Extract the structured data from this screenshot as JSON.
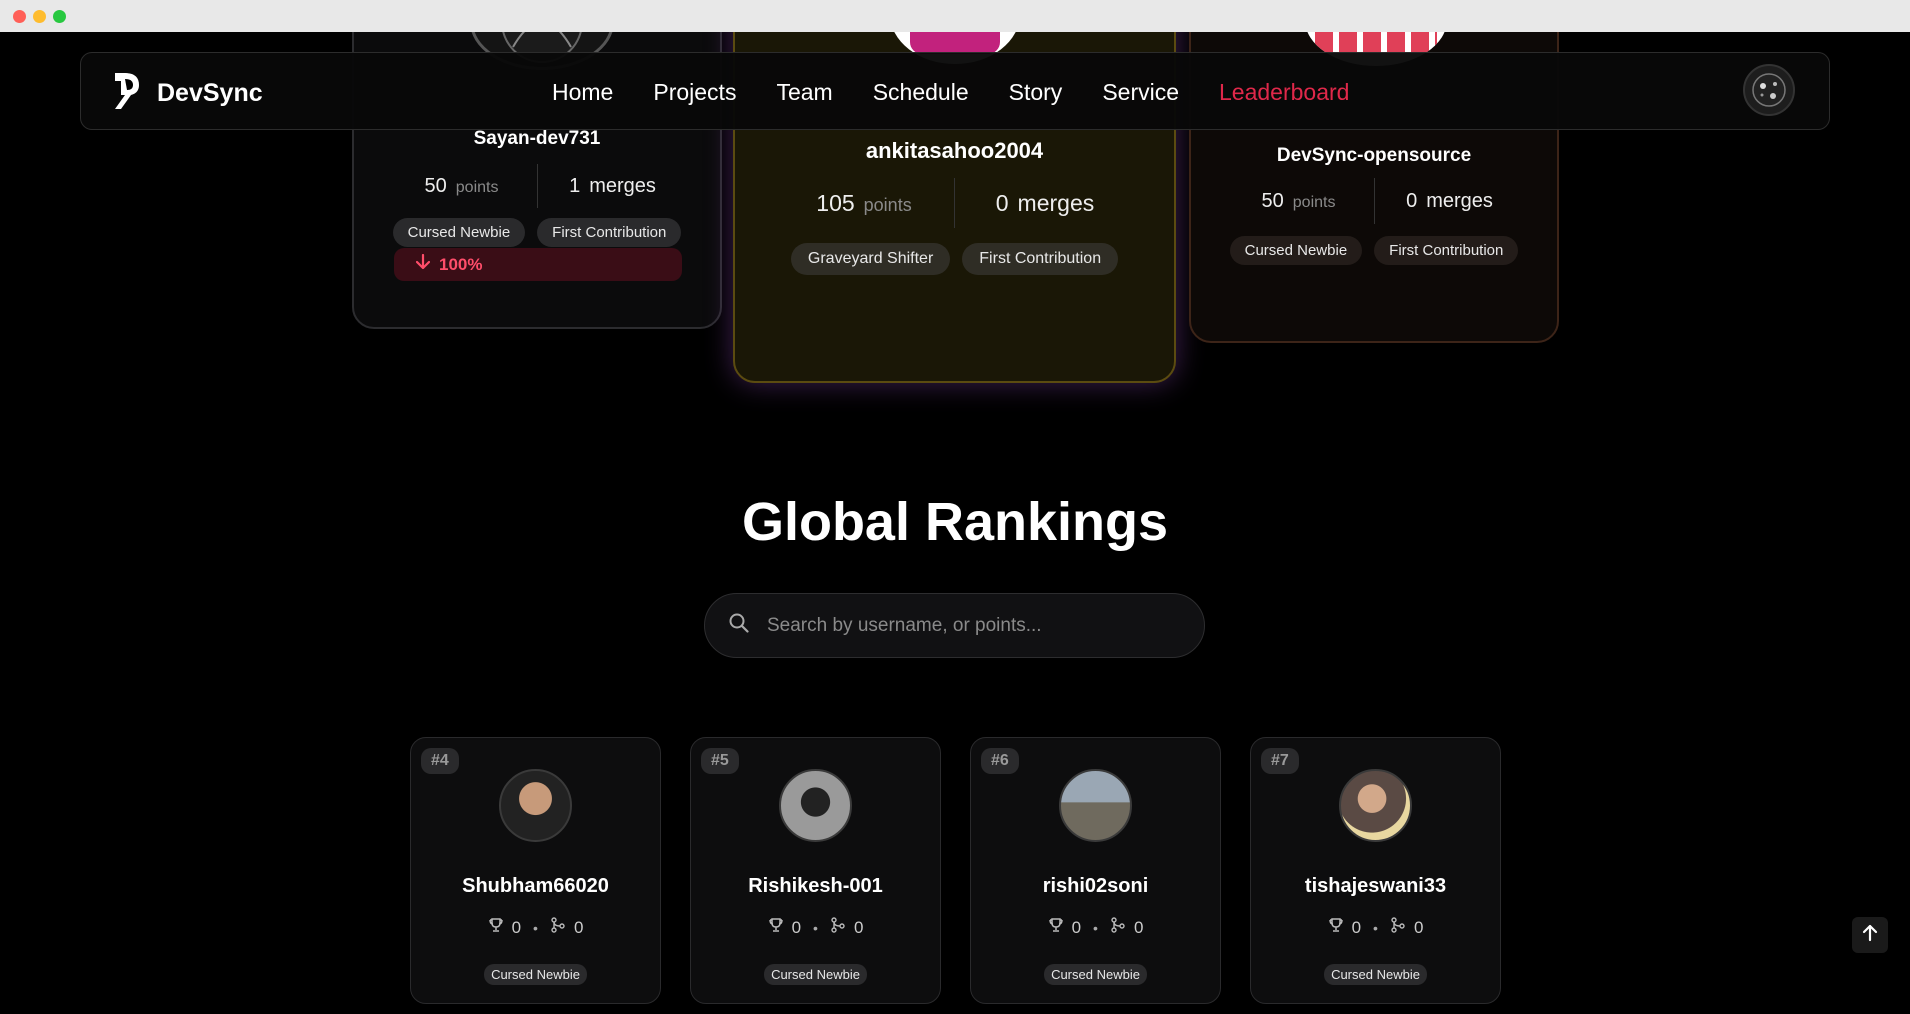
{
  "brand": {
    "name": "DevSync"
  },
  "nav": {
    "links": [
      {
        "label": "Home"
      },
      {
        "label": "Projects"
      },
      {
        "label": "Team"
      },
      {
        "label": "Schedule"
      },
      {
        "label": "Story"
      },
      {
        "label": "Service"
      },
      {
        "label": "Leaderboard",
        "active": true
      }
    ]
  },
  "podium": [
    {
      "username": "Sayan-dev731",
      "points": "50",
      "points_label": "points",
      "merges": "1",
      "merges_label": "merges",
      "badges": [
        "Cursed Newbie",
        "First Contribution"
      ],
      "trend": "100%"
    },
    {
      "username": "ankitasahoo2004",
      "points": "105",
      "points_label": "points",
      "merges": "0",
      "merges_label": "merges",
      "badges": [
        "Graveyard Shifter",
        "First Contribution"
      ]
    },
    {
      "username": "DevSync-opensource",
      "points": "50",
      "points_label": "points",
      "merges": "0",
      "merges_label": "merges",
      "badges": [
        "Cursed Newbie",
        "First Contribution"
      ]
    }
  ],
  "rankings": {
    "title": "Global Rankings",
    "search_placeholder": "Search by username, or points...",
    "cards": [
      {
        "rank": "#4",
        "username": "Shubham66020",
        "points": "0",
        "merges": "0",
        "separator": "•",
        "badge": "Cursed Newbie"
      },
      {
        "rank": "#5",
        "username": "Rishikesh-001",
        "points": "0",
        "merges": "0",
        "separator": "•",
        "badge": "Cursed Newbie"
      },
      {
        "rank": "#6",
        "username": "rishi02soni",
        "points": "0",
        "merges": "0",
        "separator": "•",
        "badge": "Cursed Newbie"
      },
      {
        "rank": "#7",
        "username": "tishajeswani33",
        "points": "0",
        "merges": "0",
        "separator": "•",
        "badge": "Cursed Newbie"
      }
    ]
  },
  "colors": {
    "accent": "#e0284a",
    "background": "#000000",
    "gold_border": "#5b4b10"
  },
  "icons": [
    "search-icon",
    "trophy-icon",
    "git-merge-icon",
    "arrow-down-icon",
    "arrow-up-icon",
    "devsync-logo"
  ]
}
